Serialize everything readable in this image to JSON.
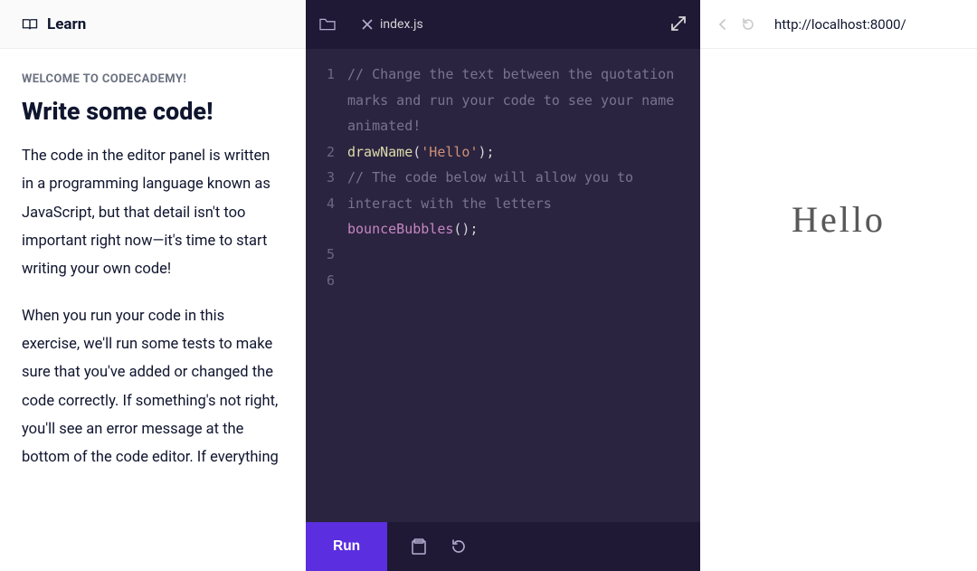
{
  "left": {
    "learn_label": "Learn",
    "welcome": "WELCOME TO CODECADEMY!",
    "title": "Write some code!",
    "para1": "The code in the editor panel is written in a programming language known as JavaScript, but that detail isn't too important right now—it's time to start writing your own code!",
    "para2": "When you run your code in this exercise, we'll run some tests to make sure that you've added or changed the code correctly. If something's not right, you'll see an error message at the bottom of the code editor. If everything"
  },
  "editor": {
    "tab_name": "index.js",
    "gutter": [
      "1",
      "2",
      "3",
      "4",
      "5",
      "6"
    ],
    "code": {
      "l1_comment": "// Change the text between the quotation marks and run your code to see your name animated!",
      "l2_fn": "drawName",
      "l2_open": "(",
      "l2_str": "'Hello'",
      "l2_close": ");",
      "l3": "",
      "l4_comment": "// The code below will allow you to interact with the letters",
      "l5_fn": "bounceBubbles",
      "l5_rest": "();",
      "l6": ""
    },
    "run_label": "Run"
  },
  "preview": {
    "url": "http://localhost:8000/",
    "output": "Hello"
  }
}
